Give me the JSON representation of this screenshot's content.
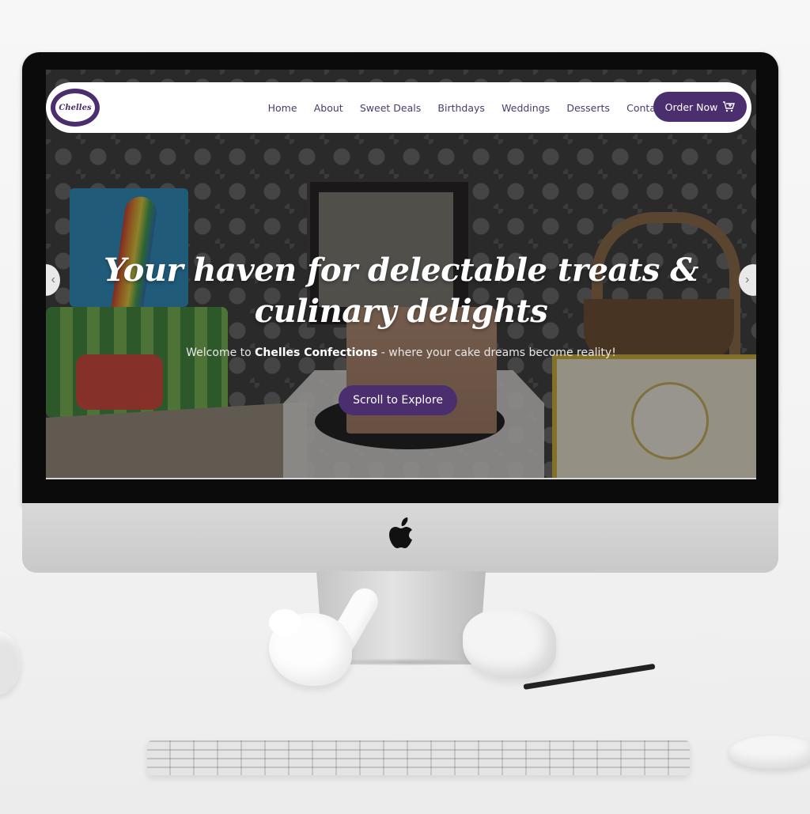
{
  "site": {
    "logo_text": "Chelles"
  },
  "nav": {
    "items": [
      "Home",
      "About",
      "Sweet Deals",
      "Birthdays",
      "Weddings",
      "Desserts",
      "Contact"
    ],
    "order_label": "Order Now"
  },
  "hero": {
    "title_line1": "Your haven for delectable treats &",
    "title_line2": "culinary delights",
    "subtitle_prefix": "Welcome to ",
    "subtitle_brand": "Chelles Confections",
    "subtitle_suffix": " - where your cake dreams become reality!",
    "cta_label": "Scroll to Explore",
    "prev_arrow": "‹",
    "next_arrow": "›"
  },
  "colors": {
    "brand_purple": "#4b2e6e",
    "nav_text": "#4b3b69",
    "white": "#ffffff"
  },
  "icons": [
    "cart-icon",
    "chevron-left-icon",
    "chevron-right-icon",
    "apple-logo-icon"
  ]
}
